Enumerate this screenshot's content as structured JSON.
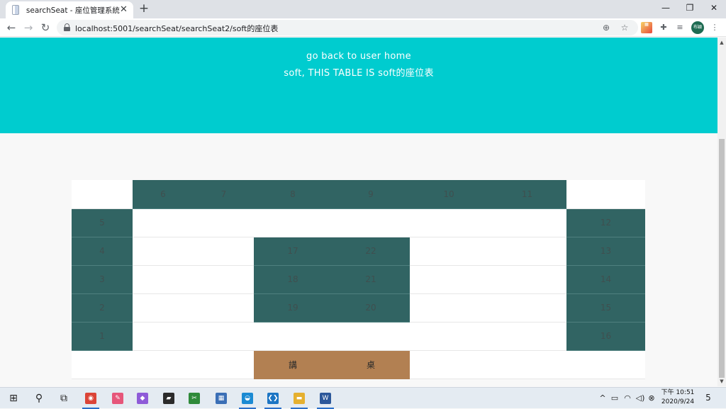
{
  "browser": {
    "tab_title": "searchSeat - 座位管理系統",
    "tab_close": "✕",
    "new_tab": "+",
    "url": "localhost:5001/searchSeat/searchSeat2/soft的座位表",
    "window_minimize": "—",
    "window_restore": "❐",
    "window_close": "✕",
    "profile_label": "布穎"
  },
  "header": {
    "home_link": "go back to user home",
    "subtitle": "soft, THIS TABLE IS soft的座位表"
  },
  "seat_table": {
    "rows": [
      [
        {
          "text": "",
          "type": "empty"
        },
        {
          "text": "6",
          "type": "seat"
        },
        {
          "text": "7",
          "type": "seat"
        },
        {
          "text": "8",
          "type": "seat"
        },
        {
          "text": "9",
          "type": "seat"
        },
        {
          "text": "10",
          "type": "seat"
        },
        {
          "text": "11",
          "type": "seat"
        },
        {
          "text": "",
          "type": "empty"
        }
      ],
      [
        {
          "text": "5",
          "type": "seat"
        },
        {
          "text": "",
          "type": "empty"
        },
        {
          "text": "",
          "type": "empty"
        },
        {
          "text": "",
          "type": "empty"
        },
        {
          "text": "",
          "type": "empty"
        },
        {
          "text": "",
          "type": "empty"
        },
        {
          "text": "",
          "type": "empty"
        },
        {
          "text": "12",
          "type": "seat"
        }
      ],
      [
        {
          "text": "4",
          "type": "seat"
        },
        {
          "text": "",
          "type": "empty"
        },
        {
          "text": "",
          "type": "empty"
        },
        {
          "text": "17",
          "type": "seat"
        },
        {
          "text": "22",
          "type": "seat"
        },
        {
          "text": "",
          "type": "empty"
        },
        {
          "text": "",
          "type": "empty"
        },
        {
          "text": "13",
          "type": "seat"
        }
      ],
      [
        {
          "text": "3",
          "type": "seat"
        },
        {
          "text": "",
          "type": "empty"
        },
        {
          "text": "",
          "type": "empty"
        },
        {
          "text": "18",
          "type": "seat"
        },
        {
          "text": "21",
          "type": "seat"
        },
        {
          "text": "",
          "type": "empty"
        },
        {
          "text": "",
          "type": "empty"
        },
        {
          "text": "14",
          "type": "seat"
        }
      ],
      [
        {
          "text": "2",
          "type": "seat"
        },
        {
          "text": "",
          "type": "empty"
        },
        {
          "text": "",
          "type": "empty"
        },
        {
          "text": "19",
          "type": "seat"
        },
        {
          "text": "20",
          "type": "seat"
        },
        {
          "text": "",
          "type": "empty"
        },
        {
          "text": "",
          "type": "empty"
        },
        {
          "text": "15",
          "type": "seat"
        }
      ],
      [
        {
          "text": "1",
          "type": "seat"
        },
        {
          "text": "",
          "type": "empty"
        },
        {
          "text": "",
          "type": "empty"
        },
        {
          "text": "",
          "type": "empty"
        },
        {
          "text": "",
          "type": "empty"
        },
        {
          "text": "",
          "type": "empty"
        },
        {
          "text": "",
          "type": "empty"
        },
        {
          "text": "16",
          "type": "seat"
        }
      ],
      [
        {
          "text": "",
          "type": "empty"
        },
        {
          "text": "",
          "type": "empty"
        },
        {
          "text": "",
          "type": "empty"
        },
        {
          "text": "講",
          "type": "desk"
        },
        {
          "text": "桌",
          "type": "desk"
        },
        {
          "text": "",
          "type": "empty"
        },
        {
          "text": "",
          "type": "empty"
        },
        {
          "text": "",
          "type": "empty"
        }
      ]
    ]
  },
  "colors": {
    "header_bg": "#00cccf",
    "seat_bg": "#316463",
    "desk_bg": "#b28052",
    "page_bg": "#f8f8f8"
  },
  "taskbar": {
    "items": [
      {
        "name": "start-icon",
        "glyph": "⊞",
        "color": "#1f1f1f"
      },
      {
        "name": "search-icon",
        "glyph": "⚲",
        "color": "#1f1f1f"
      },
      {
        "name": "task-view-icon",
        "glyph": "⧉",
        "color": "#1f1f1f"
      },
      {
        "name": "chrome-icon",
        "glyph": "◉",
        "color": "#db4437"
      },
      {
        "name": "paint-icon",
        "glyph": "✎",
        "color": "#e6567a"
      },
      {
        "name": "paint3d-icon",
        "glyph": "◆",
        "color": "#8e5bd8"
      },
      {
        "name": "sticky-notes-icon",
        "glyph": "▰",
        "color": "#2b2b2b"
      },
      {
        "name": "snip-tool-icon",
        "glyph": "✂",
        "color": "#2f8a3a"
      },
      {
        "name": "calculator-icon",
        "glyph": "▦",
        "color": "#3b6fb6"
      },
      {
        "name": "edge-icon",
        "glyph": "◒",
        "color": "#1b8ad3"
      },
      {
        "name": "vscode-icon",
        "glyph": "❮❯",
        "color": "#1c75c4"
      },
      {
        "name": "file-explorer-icon",
        "glyph": "▬",
        "color": "#e5b030"
      },
      {
        "name": "word-icon",
        "glyph": "W",
        "color": "#2b579a"
      }
    ],
    "tray": {
      "chevron": "^",
      "battery": "▭",
      "wifi": "◠",
      "volume": "◁)",
      "ime": "⊗"
    },
    "time": "下午 10:51",
    "date": "2020/9/24",
    "notifications": "5"
  }
}
